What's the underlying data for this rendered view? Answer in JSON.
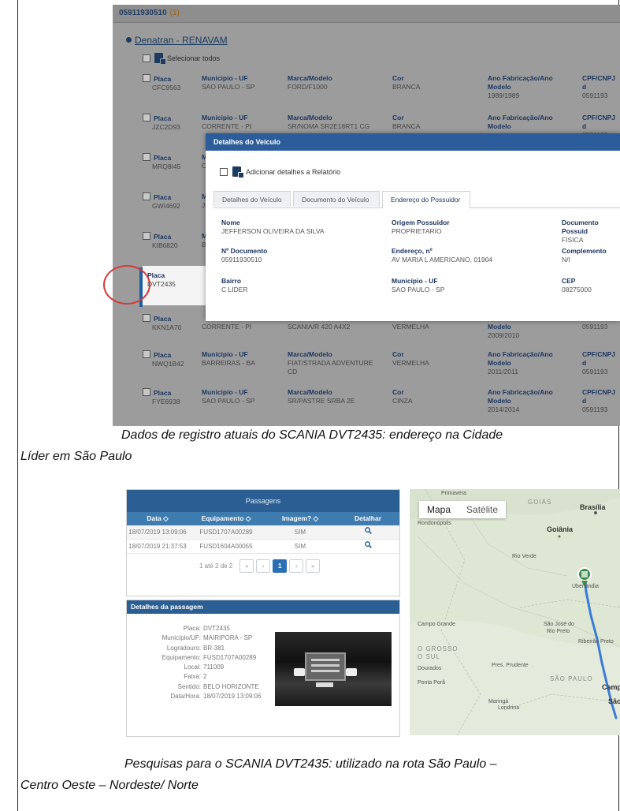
{
  "shot1": {
    "tab_code": "05911930510",
    "tab_count": "(1)",
    "section_title": "Denatran - RENAVAM",
    "select_all": "Selecionar todos",
    "rows": [
      {
        "placa": "CFC9563",
        "municipio": "SAO PAULO - SP",
        "marca": "FORD/F1000",
        "cor": "BRANCA",
        "ano": "1989/1989",
        "cpf": "0591193"
      },
      {
        "placa": "JZC2D93",
        "municipio": "CORRENTE - PI",
        "marca": "SR/NOMA SR2E18RT1 CG",
        "cor": "BRANCA",
        "ano": "",
        "cpf": "0591193"
      },
      {
        "placa": "MRQ8I45",
        "municipio": "C",
        "marca": "",
        "cor": "",
        "ano": "",
        "cpf": ""
      },
      {
        "placa": "GWI4692",
        "municipio": "JC",
        "marca": "",
        "cor": "",
        "ano": "",
        "cpf": ""
      },
      {
        "placa": "KIB6820",
        "municipio": "B",
        "marca": "",
        "cor": "",
        "ano": "",
        "cpf": ""
      },
      {
        "placa": "DVT2435",
        "municipio": "",
        "marca": "",
        "cor": "",
        "ano": "",
        "cpf": ""
      },
      {
        "placa": "KKN1A70",
        "municipio": "CORRENTE - PI",
        "marca": "SCANIA/R 420 A4X2",
        "cor": "VERMELHA",
        "ano": "2009/2010",
        "cpf": "0591193"
      },
      {
        "placa": "NWQ1B42",
        "municipio": "BARREIRAS - BA",
        "marca": "FIAT/STRADA ADVENTURE CD",
        "cor": "VERMELHA",
        "ano": "2011/2011",
        "cpf": "0591193"
      },
      {
        "placa": "FYE6938",
        "municipio": "SAO PAULO - SP",
        "marca": "SR/PASTRE SRBA 2E",
        "cor": "CINZA",
        "ano": "2014/2014",
        "cpf": "0591193"
      }
    ],
    "labels": {
      "placa": "Placa",
      "municipio": "Municipio - UF",
      "marca": "Marca/Modelo",
      "cor": "Cor",
      "ano": "Ano Fabricação/Ano",
      "ano2": "Modelo",
      "cpf": "CPF/CNPJ d",
      "m": "M"
    },
    "modal": {
      "title": "Detalhes do Veículo",
      "add": "Adicionar detalhes a Relatório",
      "tabs": [
        "Detalhes do Veículo",
        "Documento do Veículo",
        "Endereço do Possuidor"
      ],
      "fields": [
        {
          "label": "Nome",
          "value": "JEFFERSON OLIVEIRA DA SILVA"
        },
        {
          "label": "Origem Possuidor",
          "value": "PROPRIETARIO"
        },
        {
          "label": "Documento Possuid",
          "value": "FISICA"
        },
        {
          "label": "Nº Documento",
          "value": "05911930510"
        },
        {
          "label": "Endereço, nº",
          "value": "AV MARIA L AMERICANO, 01904"
        },
        {
          "label": "Complemento",
          "value": "N/I"
        },
        {
          "label": "Bairro",
          "value": "C LIDER"
        },
        {
          "label": "Município - UF",
          "value": "SAO PAULO - SP"
        },
        {
          "label": "CEP",
          "value": "08275000"
        }
      ]
    }
  },
  "caption1": {
    "line1": "Dados de registro atuais do SCANIA DVT2435: endereço na Cidade",
    "line2": "Líder em São Paulo"
  },
  "passagens": {
    "title": "Passagens",
    "headers": [
      "Data ◇",
      "Equipamento ◇",
      "Imagem? ◇",
      "Detalhar"
    ],
    "rows": [
      [
        "18/07/2019 13:09:06",
        "FUSD1707A00289",
        "SIM"
      ],
      [
        "18/07/2019 21:37:53",
        "FUSD1604A00055",
        "SIM"
      ]
    ],
    "pager_text": "1 até 2 de 2",
    "pager": [
      "«",
      "‹",
      "1",
      "›",
      "»"
    ]
  },
  "detalhes": {
    "title": "Detalhes da passagem",
    "items": [
      [
        "Placa:",
        "DVT2435"
      ],
      [
        "Município/UF:",
        "MAIRIPORA - SP"
      ],
      [
        "Logradouro:",
        "BR-381"
      ],
      [
        "Equipamento:",
        "FUSD1707A00289"
      ],
      [
        "Local:",
        "711009"
      ],
      [
        "Faixa:",
        "2"
      ],
      [
        "Sentido:",
        "BELO HORIZONTE"
      ],
      [
        "Data/Hora:",
        "18/07/2019 13:09:06"
      ]
    ]
  },
  "map": {
    "btn_map": "Mapa",
    "btn_sat": "Satélite",
    "labels": {
      "primavera": "Primavera",
      "goias": "GOIÁS",
      "brasilia": "Brasília",
      "rondonopolis": "Rondonópolis",
      "goiania": "Goiânia",
      "rio_verde": "Rio Verde",
      "uberlandia": "Uberlândia",
      "campo_grande": "Campo Grande",
      "sao_jose": "São José do",
      "rio_preto": "Rio Preto",
      "ribeirao": "Ribeirão Preto",
      "grosso": "O GROSSO",
      "sul": "O SUL",
      "dourados": "Dourados",
      "pres_prudente": "Pres. Prudente",
      "ponta_pora": "Ponta Porã",
      "sao_paulo_state": "SÃO PAULO",
      "campinas": "Campi",
      "sao": "São",
      "maringa": "Maringá",
      "londrina": "Londrina"
    }
  },
  "caption2": {
    "line1": "Pesquisas para o SCANIA DVT2435: utilizado na rota São Paulo –",
    "line2": "Centro Oeste – Nordeste/ Norte"
  }
}
